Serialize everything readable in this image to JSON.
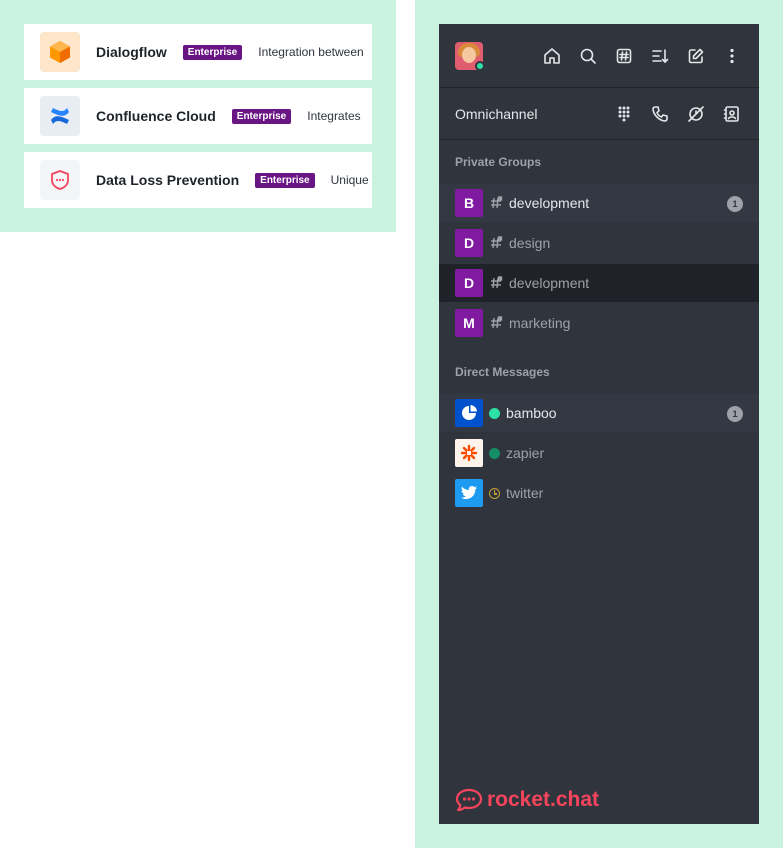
{
  "apps": [
    {
      "name": "Dialogflow",
      "badge": "Enterprise",
      "description": "Integration between",
      "icon": "cube-icon"
    },
    {
      "name": "Confluence Cloud",
      "badge": "Enterprise",
      "description": "Integrates",
      "icon": "confluence-icon"
    },
    {
      "name": "Data Loss Prevention",
      "badge": "Enterprise",
      "description": "Unique",
      "icon": "shield-icon"
    }
  ],
  "sidebar": {
    "omnichannel_title": "Omnichannel",
    "private_groups_title": "Private Groups",
    "direct_messages_title": "Direct Messages",
    "private_groups": [
      {
        "initial": "B",
        "name": "development",
        "unread": "1",
        "color": "#7f1aa1"
      },
      {
        "initial": "D",
        "name": "design",
        "unread": "",
        "color": "#7f1aa1"
      },
      {
        "initial": "D",
        "name": "development",
        "unread": "",
        "color": "#7f1aa1"
      },
      {
        "initial": "M",
        "name": "marketing",
        "unread": "",
        "color": "#7f1aa1"
      }
    ],
    "direct_messages": [
      {
        "name": "bamboo",
        "unread": "1",
        "status": "online",
        "icon": "bamboo-icon"
      },
      {
        "name": "zapier",
        "unread": "",
        "status": "online",
        "icon": "zapier-icon"
      },
      {
        "name": "twitter",
        "unread": "",
        "status": "away",
        "icon": "twitter-icon"
      }
    ],
    "brand": "rocket.chat"
  },
  "colors": {
    "accent": "#f5455c",
    "badge": "#6a1584",
    "background": "#c9f2e1",
    "sidebar": "#2f343d",
    "online": "#2de0a5",
    "away": "#c8a033"
  }
}
